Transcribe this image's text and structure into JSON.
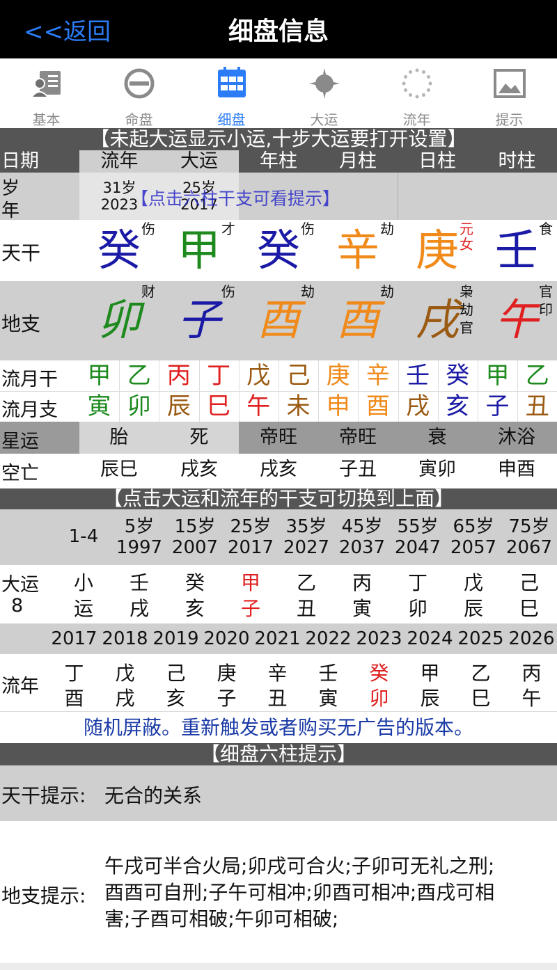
{
  "nav": {
    "back": "<<返回",
    "title": "细盘信息"
  },
  "tabs": [
    {
      "label": "基本",
      "icon": "person-card-icon",
      "active": false
    },
    {
      "label": "命盘",
      "icon": "circle-minus-icon",
      "active": false
    },
    {
      "label": "细盘",
      "icon": "grid-icon",
      "active": true
    },
    {
      "label": "大运",
      "icon": "compass-icon",
      "active": false
    },
    {
      "label": "流年",
      "icon": "dotted-circle-icon",
      "active": false
    },
    {
      "label": "提示",
      "icon": "image-icon",
      "active": false
    }
  ],
  "notice1": "【未起大运显示小运,十步大运要打开设置】",
  "pillar_header": [
    "日期",
    "流年",
    "大运",
    "年柱",
    "月柱",
    "日柱",
    "时柱"
  ],
  "age_row": {
    "label_top": "岁",
    "label_bottom": "年",
    "liunian_age": "31岁",
    "liunian_year": "2023",
    "dayun_age": "25岁",
    "dayun_year": "2017",
    "tip": "【点击六柱干支可看提示】"
  },
  "tiangan": {
    "label": "天干",
    "cells": [
      {
        "char": "癸",
        "god": "伤",
        "color": "#1a1aa6"
      },
      {
        "char": "甲",
        "god": "才",
        "color": "#1e8a1e"
      },
      {
        "char": "癸",
        "god": "伤",
        "color": "#1a1aa6"
      },
      {
        "char": "辛",
        "god": "劫",
        "color": "#f08a1a"
      },
      {
        "char": "庚",
        "god": "元\n女",
        "color": "#f08a1a",
        "god_color": "#e02020"
      },
      {
        "char": "壬",
        "god": "食",
        "color": "#1a1aa6"
      }
    ]
  },
  "dizhi": {
    "label": "地支",
    "cells": [
      {
        "char": "卯",
        "god": "财",
        "color": "#1e8a1e"
      },
      {
        "char": "子",
        "god": "伤",
        "color": "#1a1aa6"
      },
      {
        "char": "酉",
        "god": "劫",
        "color": "#f08a1a"
      },
      {
        "char": "酉",
        "god": "劫",
        "color": "#f08a1a"
      },
      {
        "char": "戌",
        "god": "枭\n劫\n官",
        "color": "#9a5a12"
      },
      {
        "char": "午",
        "god": "官\n印",
        "color": "#e02020"
      }
    ]
  },
  "liuyue_gan": {
    "label": "流月干",
    "cells": [
      {
        "c": "甲",
        "color": "#1e8a1e"
      },
      {
        "c": "乙",
        "color": "#1e8a1e"
      },
      {
        "c": "丙",
        "color": "#e02020"
      },
      {
        "c": "丁",
        "color": "#e02020"
      },
      {
        "c": "戊",
        "color": "#9a5a12"
      },
      {
        "c": "己",
        "color": "#9a5a12"
      },
      {
        "c": "庚",
        "color": "#f08a1a"
      },
      {
        "c": "辛",
        "color": "#f08a1a"
      },
      {
        "c": "壬",
        "color": "#1a1aa6"
      },
      {
        "c": "癸",
        "color": "#1a1aa6"
      },
      {
        "c": "甲",
        "color": "#1e8a1e"
      },
      {
        "c": "乙",
        "color": "#1e8a1e"
      }
    ]
  },
  "liuyue_zhi": {
    "label": "流月支",
    "cells": [
      {
        "c": "寅",
        "color": "#1e8a1e"
      },
      {
        "c": "卯",
        "color": "#1e8a1e"
      },
      {
        "c": "辰",
        "color": "#9a5a12"
      },
      {
        "c": "巳",
        "color": "#e02020"
      },
      {
        "c": "午",
        "color": "#e02020"
      },
      {
        "c": "未",
        "color": "#9a5a12"
      },
      {
        "c": "申",
        "color": "#f08a1a"
      },
      {
        "c": "酉",
        "color": "#f08a1a"
      },
      {
        "c": "戌",
        "color": "#9a5a12"
      },
      {
        "c": "亥",
        "color": "#1a1aa6"
      },
      {
        "c": "子",
        "color": "#1a1aa6"
      },
      {
        "c": "丑",
        "color": "#9a5a12"
      }
    ]
  },
  "xingyun": {
    "label": "星运",
    "cells": [
      "胎",
      "死",
      "帝旺",
      "帝旺",
      "衰",
      "沐浴"
    ]
  },
  "kongwang": {
    "label": "空亡",
    "cells": [
      "辰巳",
      "戌亥",
      "戌亥",
      "子丑",
      "寅卯",
      "申酉"
    ]
  },
  "notice2": "【点击大运和流年的干支可切换到上面】",
  "dayun_ages": {
    "first": "1-4",
    "items": [
      {
        "age": "5岁",
        "year": "1997"
      },
      {
        "age": "15岁",
        "year": "2007"
      },
      {
        "age": "25岁",
        "year": "2017"
      },
      {
        "age": "35岁",
        "year": "2027"
      },
      {
        "age": "45岁",
        "year": "2037"
      },
      {
        "age": "55岁",
        "year": "2047"
      },
      {
        "age": "65岁",
        "year": "2057"
      },
      {
        "age": "75岁",
        "year": "2067"
      }
    ]
  },
  "dayun": {
    "label_top": "大运",
    "label_bottom": "8",
    "items": [
      {
        "t": "小",
        "b": "运",
        "active": false
      },
      {
        "t": "壬",
        "b": "戌",
        "active": false
      },
      {
        "t": "癸",
        "b": "亥",
        "active": false
      },
      {
        "t": "甲",
        "b": "子",
        "active": true
      },
      {
        "t": "乙",
        "b": "丑",
        "active": false
      },
      {
        "t": "丙",
        "b": "寅",
        "active": false
      },
      {
        "t": "丁",
        "b": "卯",
        "active": false
      },
      {
        "t": "戊",
        "b": "辰",
        "active": false
      },
      {
        "t": "己",
        "b": "巳",
        "active": false
      }
    ]
  },
  "liunian_years": [
    "2017",
    "2018",
    "2019",
    "2020",
    "2021",
    "2022",
    "2023",
    "2024",
    "2025",
    "2026"
  ],
  "liunian": {
    "label": "流年",
    "items": [
      {
        "t": "丁",
        "b": "酉",
        "active": false
      },
      {
        "t": "戊",
        "b": "戌",
        "active": false
      },
      {
        "t": "己",
        "b": "亥",
        "active": false
      },
      {
        "t": "庚",
        "b": "子",
        "active": false
      },
      {
        "t": "辛",
        "b": "丑",
        "active": false
      },
      {
        "t": "壬",
        "b": "寅",
        "active": false
      },
      {
        "t": "癸",
        "b": "卯",
        "active": true
      },
      {
        "t": "甲",
        "b": "辰",
        "active": false
      },
      {
        "t": "乙",
        "b": "巳",
        "active": false
      },
      {
        "t": "丙",
        "b": "午",
        "active": false
      }
    ]
  },
  "ad_text": "随机屏蔽。重新触发或者购买无广告的版本。",
  "notice3": "【细盘六柱提示】",
  "tiangan_tip": {
    "label": "天干提示:",
    "text": "无合的关系"
  },
  "dizhi_tip": {
    "label": "地支提示:",
    "lines": [
      "午戌可半合火局;卯戌可合火;子卯可无礼之刑;",
      "酉酉可自刑;子午可相冲;卯酉可相冲;酉戌可相",
      "害;子酉可相破;午卯可相破;"
    ]
  },
  "colors": {
    "accent": "#2b7cf6",
    "active_red": "#e02020",
    "ad_blue": "#1a3aa6"
  }
}
